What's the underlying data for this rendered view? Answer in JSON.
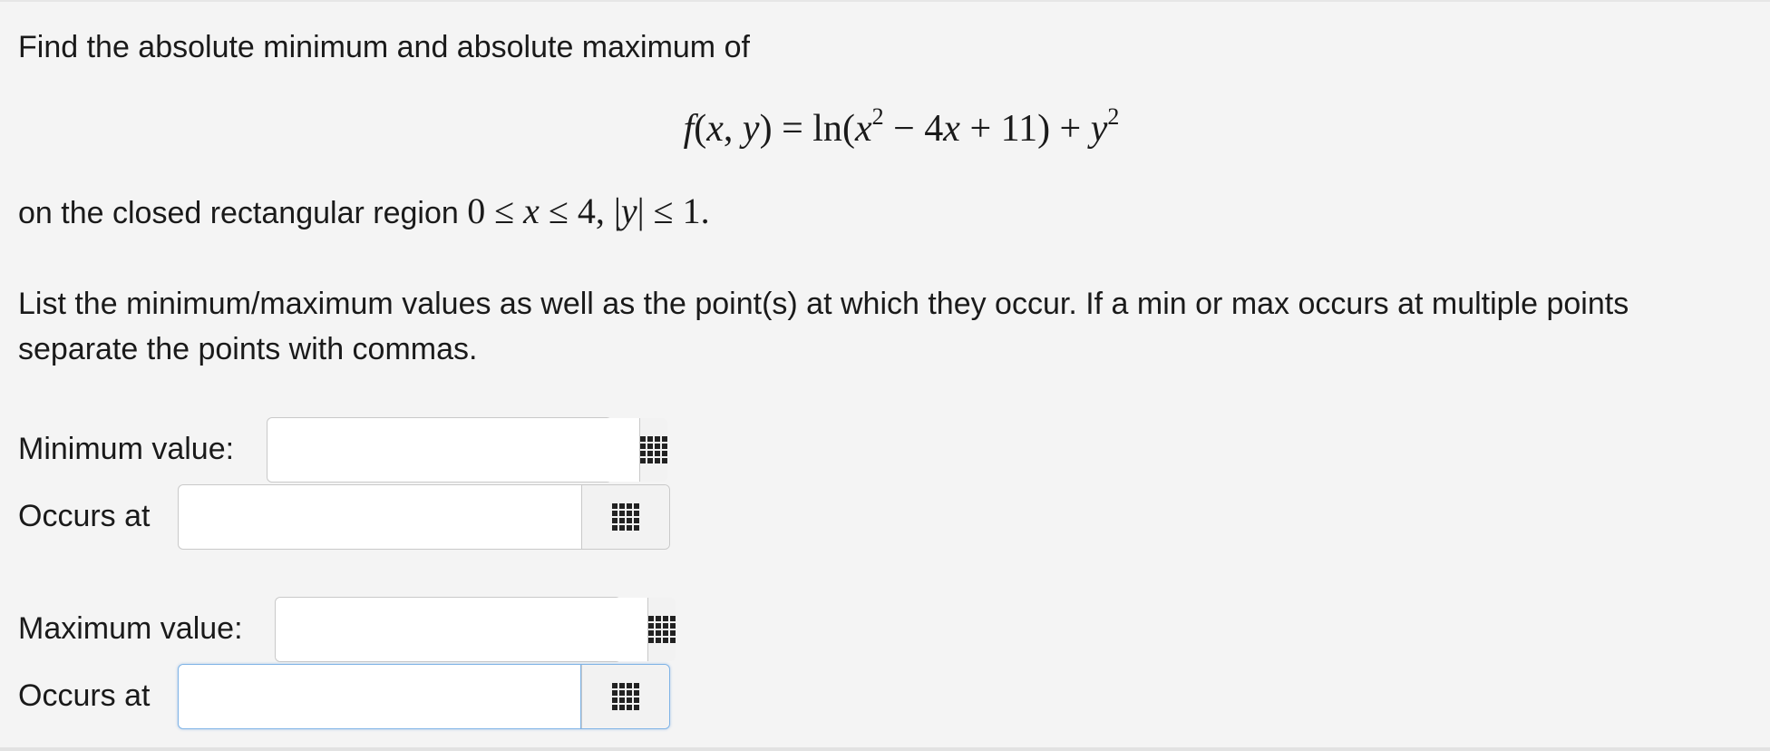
{
  "problem": {
    "intro": "Find the absolute minimum and absolute maximum of",
    "formula": {
      "fname": "f",
      "args_open": "(",
      "arg_x": "x",
      "comma": ", ",
      "arg_y": "y",
      "args_close": ")",
      "equals": " = ",
      "ln": "ln",
      "paren_open": "(",
      "x1": "x",
      "exp1": "2",
      "minus": " − 4",
      "x2": "x",
      "plus11": " + 11) + ",
      "y1": "y",
      "exp2": "2"
    },
    "region_prefix": "on the closed rectangular region ",
    "region": {
      "zero": "0 ≤ ",
      "x": "x",
      "le4": " ≤ 4, |",
      "y": "y",
      "le1": "| ≤ 1."
    },
    "instructions_line1": "List the minimum/maximum values as well as the point(s) at which they occur. If a min or max occurs at multiple points",
    "instructions_line2": "separate the points with commas."
  },
  "answers": {
    "min_value_label": "Minimum value:",
    "min_occurs_label": "Occurs at",
    "max_value_label": "Maximum value:",
    "max_occurs_label": "Occurs at",
    "min_value": "",
    "min_occurs": "",
    "max_value": "",
    "max_occurs": ""
  },
  "icons": {
    "palette": "grid-icon"
  }
}
